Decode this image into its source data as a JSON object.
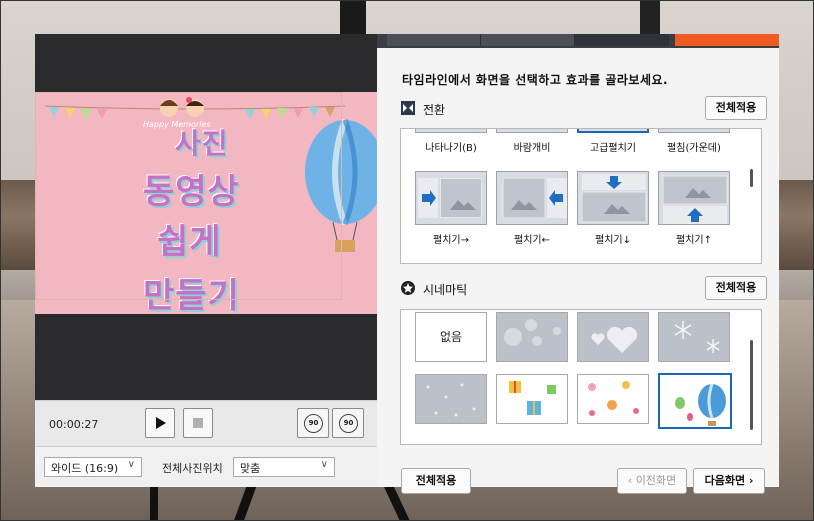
{
  "left_panel": {
    "preview": {
      "title_lines": [
        "사진",
        "동영상",
        "쉽게",
        "만들기"
      ],
      "happy_text": "Happy Memories"
    },
    "player": {
      "time": "00:00:27",
      "rotate_left_label": "90",
      "rotate_right_label": "90"
    },
    "settings": {
      "ratio_value": "와이드 (16:9)",
      "position_label": "전체사진위치",
      "position_value": "맞춤"
    }
  },
  "right_panel": {
    "instruction": "타임라인에서 화면을 선택하고 효과를 골라보세요.",
    "transition": {
      "title": "전환",
      "apply_all_label": "전체적용",
      "top_row": [
        "나타나기(B)",
        "바람개비",
        "고급펼치기",
        "펼침(가운데)"
      ],
      "items": [
        {
          "label": "펼치기→",
          "icon": "arrow-right-icon"
        },
        {
          "label": "펼치기←",
          "icon": "arrow-left-icon"
        },
        {
          "label": "펼치기↓",
          "icon": "arrow-down-icon"
        },
        {
          "label": "펼치기↑",
          "icon": "arrow-up-icon"
        }
      ]
    },
    "cinematic": {
      "title": "시네마틱",
      "apply_all_label": "전체적용",
      "none_label": "없음",
      "items": [
        "없음",
        "bokeh",
        "hearts",
        "snowflakes",
        "dots",
        "gifts",
        "flowers",
        "balloons"
      ],
      "selected_index": 7
    },
    "footer": {
      "apply_all_label": "전체적용",
      "prev_label": "‹ 이전화면",
      "next_label": "다음화면 ›"
    }
  },
  "colors": {
    "accent_orange": "#f05a24",
    "selection_blue": "#1b66b7",
    "transition_arrow": "#1f6fc0"
  }
}
